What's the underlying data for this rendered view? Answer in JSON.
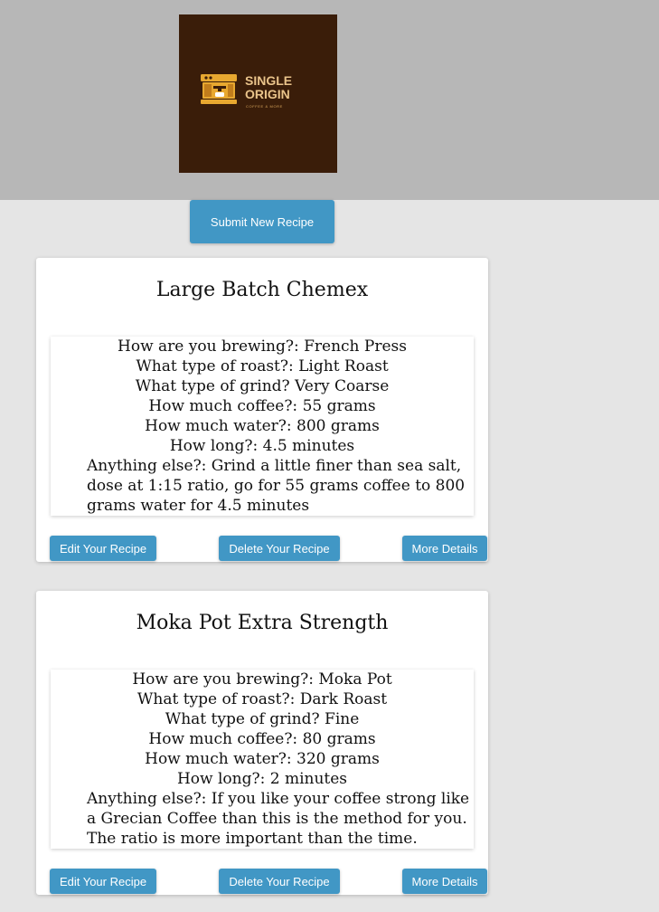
{
  "header": {
    "logo": {
      "title": "SINGLE\nORIGIN",
      "tagline": "COFFEE & MORE",
      "background": "#3a1d09",
      "accent": "#e8a830"
    }
  },
  "submit_button": {
    "label": "Submit New Recipe"
  },
  "recipes": [
    {
      "title": "Large Batch Chemex",
      "brewing": "How are you brewing?: French Press",
      "roast": "What type of roast?: Light Roast",
      "grind": "What type of grind? Very Coarse",
      "coffee": "How much coffee?: 55 grams",
      "water": "How much water?: 800 grams",
      "time": "How long?: 4.5 minutes",
      "notes": "Anything else?: Grind a little finer than sea salt, dose at 1:15 ratio, go for 55 grams coffee to 800 grams water for 4.5 minutes",
      "edit_label": "Edit Your Recipe",
      "delete_label": "Delete Your Recipe",
      "details_label": "More Details"
    },
    {
      "title": "Moka Pot Extra Strength",
      "brewing": "How are you brewing?: Moka Pot",
      "roast": "What type of roast?: Dark Roast",
      "grind": "What type of grind? Fine",
      "coffee": "How much coffee?: 80 grams",
      "water": "How much water?: 320 grams",
      "time": "How long?: 2 minutes",
      "notes": "Anything else?: If you like your coffee strong like a Grecian Coffee than this is the method for you. The ratio is more important than the time.",
      "edit_label": "Edit Your Recipe",
      "delete_label": "Delete Your Recipe",
      "details_label": "More Details"
    }
  ],
  "colors": {
    "header_bg": "#b7b7b7",
    "page_bg": "#e5e5e5",
    "button": "#4197c5"
  }
}
